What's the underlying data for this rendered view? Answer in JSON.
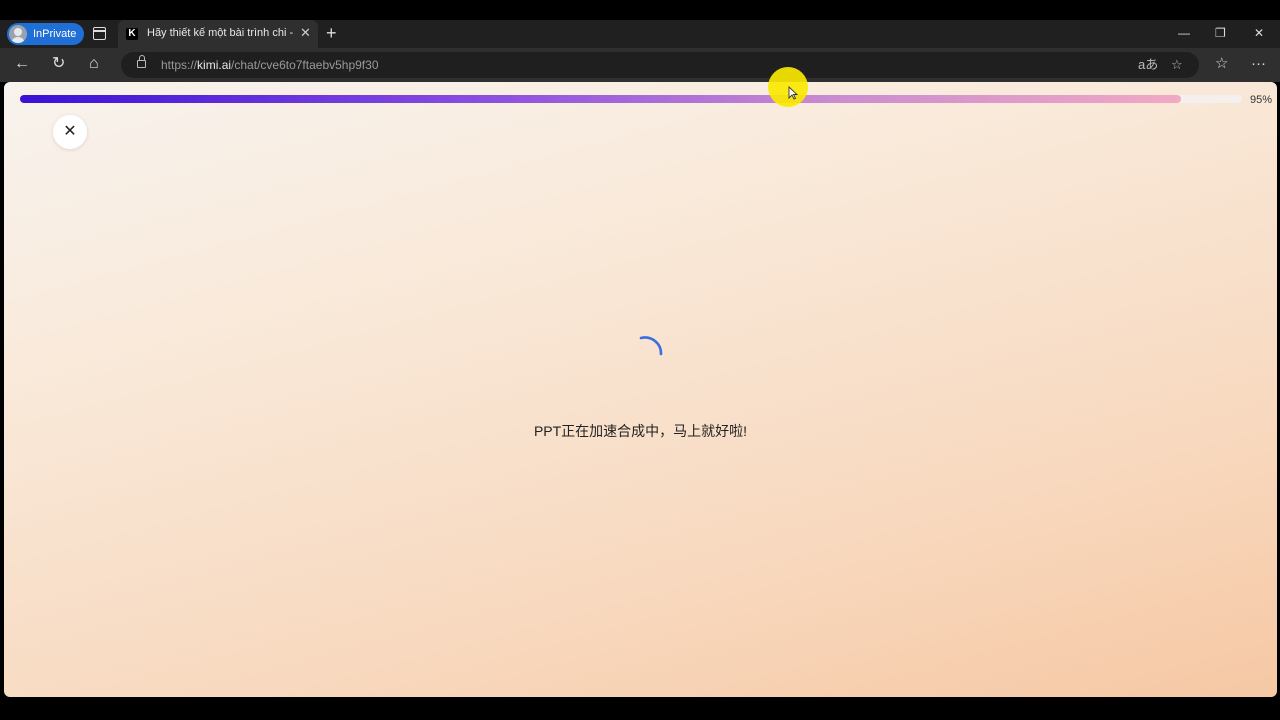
{
  "browser": {
    "profile_label": "InPrivate",
    "tab": {
      "favicon": "K",
      "title": "Hãy thiết kế một bài trình chi - Kimi",
      "close": "✕"
    },
    "new_tab": "+",
    "window": {
      "minimize": "—",
      "restore": "❐",
      "close": "✕"
    },
    "nav": {
      "back": "←",
      "reload": "↻",
      "home": "⌂"
    },
    "address": {
      "scheme": "https://",
      "host": "kimi.ai",
      "path": "/chat/cve6to7ftaebv5hp9f30"
    },
    "address_icons": {
      "read_aloud": "aあ",
      "favorite": "☆"
    },
    "toolbar_icons": {
      "favorites": "☆",
      "more": "···"
    }
  },
  "page": {
    "progress": {
      "percent": 95,
      "label": "95%",
      "colors": [
        "#3b10d6",
        "#f2a9c4"
      ]
    },
    "close_label": "✕",
    "status_text": "PPT正在加速合成中，马上就好啦!",
    "spinner_color": "#3b6fe0"
  }
}
